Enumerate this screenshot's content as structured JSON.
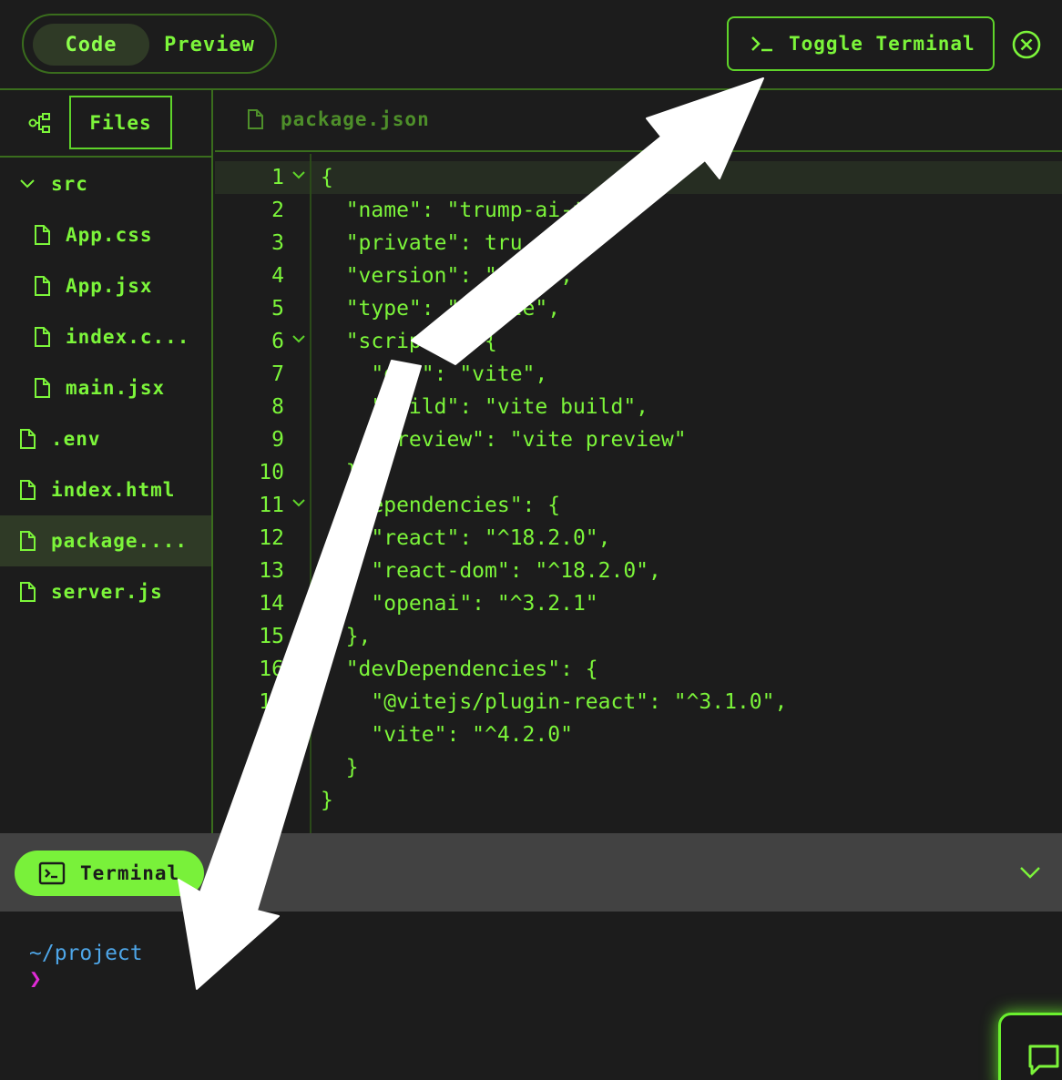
{
  "header": {
    "mode_tabs": [
      {
        "label": "Code",
        "active": true
      },
      {
        "label": "Preview",
        "active": false
      }
    ],
    "toggle_terminal_label": "Toggle Terminal",
    "close_icon": "close-circle-icon"
  },
  "sidebar": {
    "files_tab_label": "Files",
    "tree_icon": "file-tree-icon",
    "items": [
      {
        "label": "src",
        "kind": "folder",
        "expanded": true
      },
      {
        "label": "App.css",
        "kind": "file"
      },
      {
        "label": "App.jsx",
        "kind": "file"
      },
      {
        "label": "index.c...",
        "kind": "file"
      },
      {
        "label": "main.jsx",
        "kind": "file"
      },
      {
        "label": ".env",
        "kind": "file"
      },
      {
        "label": "index.html",
        "kind": "file"
      },
      {
        "label": "package....",
        "kind": "file",
        "active": true
      },
      {
        "label": "server.js",
        "kind": "file"
      }
    ]
  },
  "editor": {
    "open_file": "package.json",
    "lines": [
      {
        "n": "1",
        "fold": true,
        "code": "{"
      },
      {
        "n": "2",
        "fold": false,
        "code": "  \"name\": \"trump-ai-t\","
      },
      {
        "n": "3",
        "fold": false,
        "code": "  \"private\": tru"
      },
      {
        "n": "4",
        "fold": false,
        "code": "  \"version\": \".0.0\","
      },
      {
        "n": "5",
        "fold": false,
        "code": "  \"type\": \"module\","
      },
      {
        "n": "6",
        "fold": true,
        "code": "  \"scripts\": {"
      },
      {
        "n": "7",
        "fold": false,
        "code": "    \"dev\": \"vite\","
      },
      {
        "n": "8",
        "fold": false,
        "code": "    \"build\": \"vite build\","
      },
      {
        "n": "9",
        "fold": false,
        "code": "    \"preview\": \"vite preview\""
      },
      {
        "n": "10",
        "fold": false,
        "code": "  },"
      },
      {
        "n": "11",
        "fold": true,
        "code": "  \"dependencies\": {"
      },
      {
        "n": "12",
        "fold": false,
        "code": "    \"react\": \"^18.2.0\","
      },
      {
        "n": "13",
        "fold": false,
        "code": "    \"react-dom\": \"^18.2.0\","
      },
      {
        "n": "14",
        "fold": false,
        "code": "    \"openai\": \"^3.2.1\""
      },
      {
        "n": "15",
        "fold": false,
        "code": "  },"
      },
      {
        "n": "16",
        "fold": false,
        "code": "  \"devDependencies\": {"
      },
      {
        "n": "17",
        "fold": false,
        "code": "    \"@vitejs/plugin-react\": \"^3.1.0\","
      },
      {
        "n": "18",
        "fold": false,
        "code": "    \"vite\": \"^4.2.0\""
      },
      {
        "n": "19",
        "fold": false,
        "code": "  }"
      },
      {
        "n": "20",
        "fold": false,
        "code": "}"
      }
    ]
  },
  "terminal": {
    "tab_label": "Terminal",
    "path": "~/project",
    "caret": "❯"
  },
  "colors": {
    "accent": "#7cf53a",
    "border": "#3a6d1d",
    "background": "#1c1c1c",
    "terminal_bar": "#424242",
    "path_blue": "#4ea6e8",
    "caret_magenta": "#e02bd6"
  }
}
